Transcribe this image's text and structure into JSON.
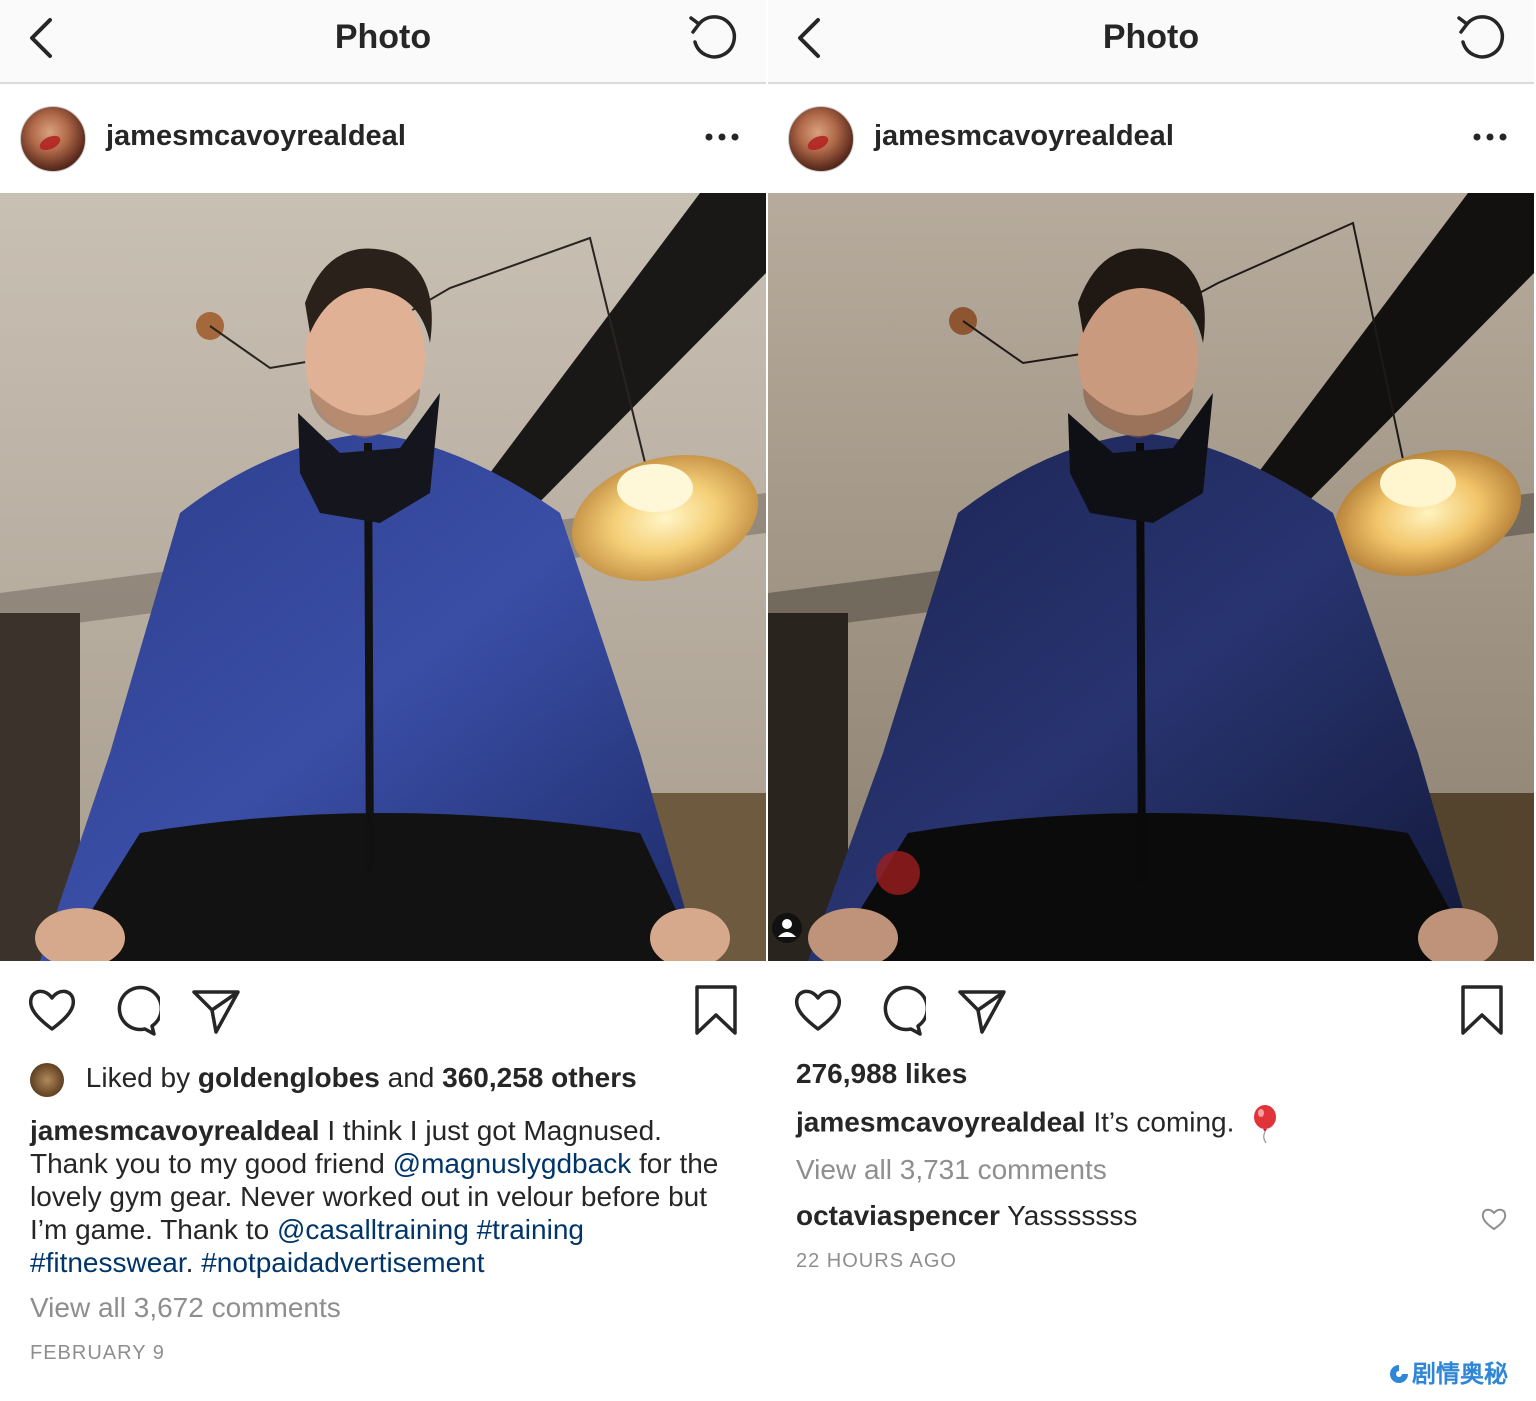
{
  "left": {
    "nav": {
      "title": "Photo"
    },
    "post": {
      "username": "jamesmcavoyrealdeal",
      "liked_by_prefix": "Liked by",
      "liked_by_user": "goldenglobes",
      "liked_by_mid": "and",
      "liked_by_count": "360,258 others",
      "caption_user": "jamesmcavoyrealdeal",
      "caption_part1": "I think I just got Magnused. Thank you to my good friend",
      "mention1": "@magnuslygdback",
      "caption_part2": "for the lovely gym gear. Never worked out in velour before but I’m game. Thank to",
      "mention2": "@casalltraining",
      "hashtag1": "#training",
      "hashtag2": "#fitnesswear",
      "caption_dot": ".",
      "hashtag3": "#notpaidadvertisement",
      "view_all": "View all 3,672 comments",
      "date": "FEBRUARY 9"
    }
  },
  "right": {
    "nav": {
      "title": "Photo"
    },
    "post": {
      "username": "jamesmcavoyrealdeal",
      "likes": "276,988 likes",
      "caption_user": "jamesmcavoyrealdeal",
      "caption_text": "It’s coming.",
      "view_all": "View all 3,731 comments",
      "comment_user": "octaviaspencer",
      "comment_text": "Yasssssss",
      "time": "22 HOURS AGO"
    }
  },
  "icons": {
    "back": "chevron-left-icon",
    "refresh": "refresh-icon",
    "more": "more-horizontal-icon",
    "like": "heart-icon",
    "comment": "comment-bubble-icon",
    "share": "paper-plane-icon",
    "save": "bookmark-icon",
    "balloon": "red-balloon-emoji"
  },
  "colors": {
    "text": "#262626",
    "muted": "#8e8e8e",
    "link": "#003569",
    "navbar_bg": "#fafafa",
    "watermark": "#2f86d6"
  },
  "watermark": {
    "text": "剧情奥秘"
  }
}
